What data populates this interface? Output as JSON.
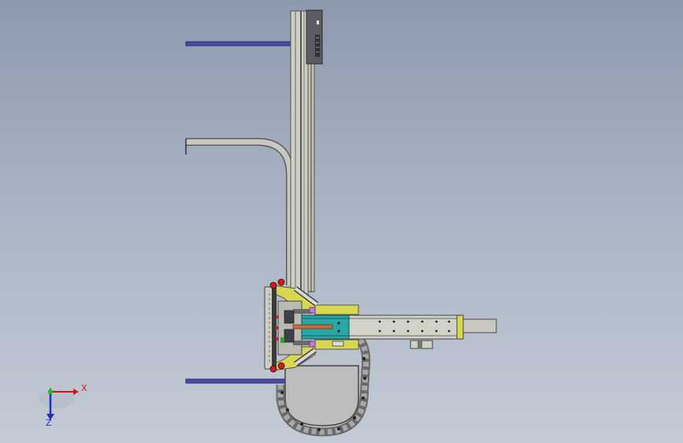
{
  "view": {
    "background_top": "#8d9aae",
    "background_bottom": "#c4cbd6"
  },
  "triad": {
    "x_label": "X",
    "z_label": "Z",
    "x_color": "#d01818",
    "y_color": "#18c018",
    "z_color": "#1a2fc8"
  },
  "model": {
    "frame_color": "#c8c8bc",
    "bar_color": "#4a4aa6",
    "yellow_color": "#d8d850",
    "teal_color": "#2aa6a6",
    "chain_color": "#777777"
  }
}
